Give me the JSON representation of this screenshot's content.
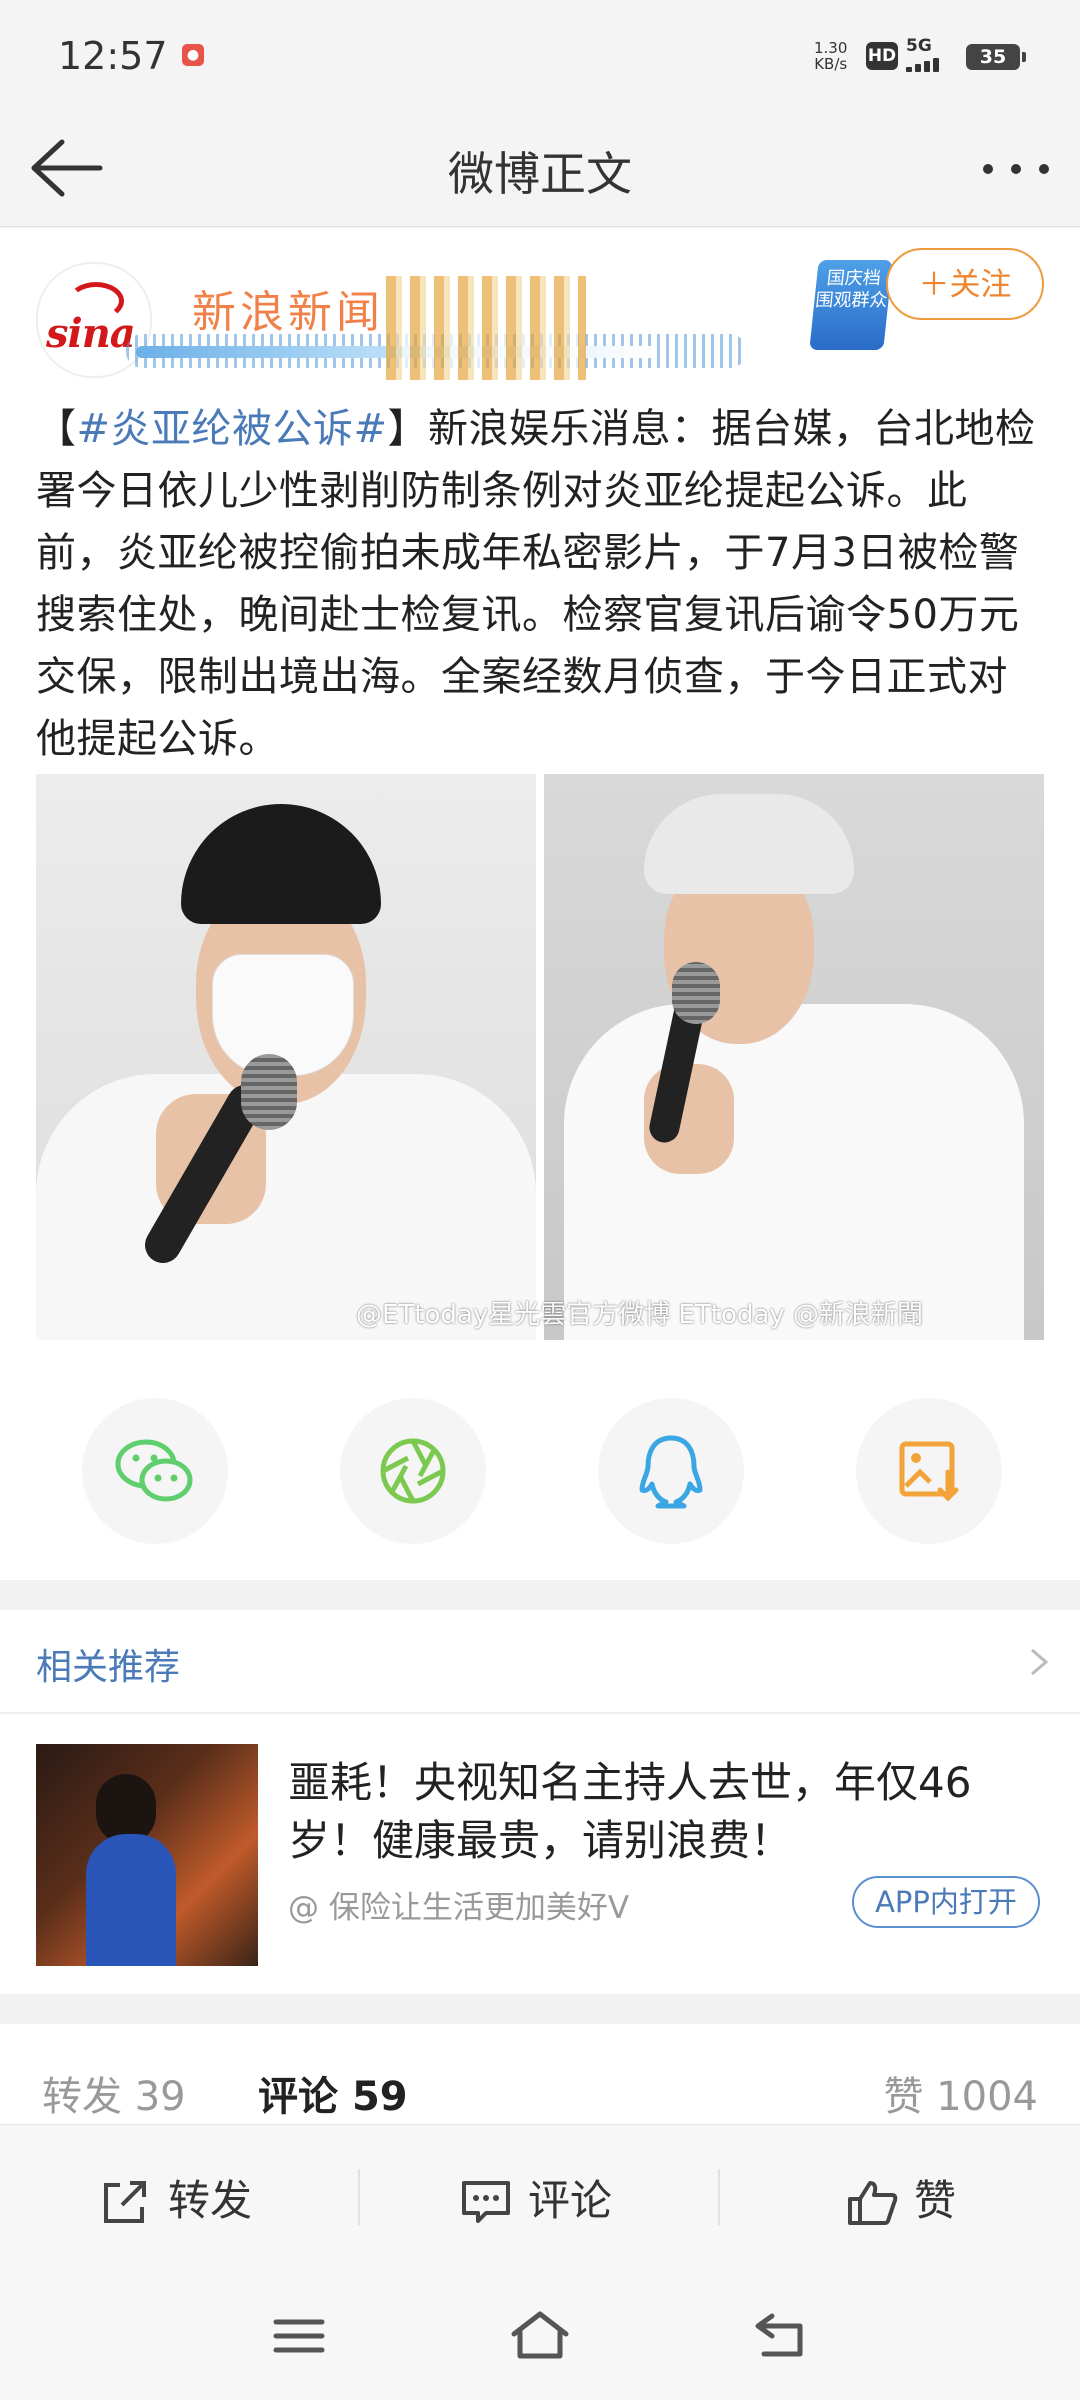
{
  "status_bar": {
    "time": "12:57",
    "net_speed_value": "1.30",
    "net_speed_unit": "KB/s",
    "hd": "HD",
    "signal": "5G",
    "battery": "35"
  },
  "nav": {
    "title": "微博正文",
    "back_icon": "arrow-left-icon",
    "more_icon": "more-dots-icon"
  },
  "post": {
    "banner_text": "新浪新闻",
    "promo_text_line1": "国庆档",
    "promo_text_line2": "围观群众",
    "follow_label": "＋关注",
    "hashtag": "#炎亚纶被公诉#",
    "bracket_open": "【",
    "bracket_close": "】",
    "body": "新浪娱乐消息：据台媒，台北地检署今日依儿少性剥削防制条例对炎亚纶提起公诉。此前，炎亚纶被控偷拍未成年私密影片，于7月3日被检警搜索住处，晚间赴士检复讯。检察官复讯后谕令50万元交保，限制出境出海。全案经数月侦查，于今日正式对他提起公诉。",
    "image_watermark": "@ETtoday星光雲官方微博 ETtoday @新浪新聞"
  },
  "share": [
    "wechat-icon",
    "moments-icon",
    "qq-icon",
    "save-image-icon"
  ],
  "related": {
    "header": "相关推荐",
    "title": "噩耗！央视知名主持人去世，年仅46岁！健康最贵，请别浪费！",
    "source": "@ 保险让生活更加美好V",
    "open_app": "APP内打开"
  },
  "stats": {
    "repost_label": "转发",
    "repost_count": "39",
    "comment_label": "评论",
    "comment_count": "59",
    "like_label": "赞",
    "like_count": "1004"
  },
  "actions": {
    "repost": "转发",
    "comment": "评论",
    "like": "赞"
  },
  "colors": {
    "link_blue": "#4b7ab8",
    "follow_orange": "#f0852f",
    "wechat_green": "#5fcf6e",
    "qq_blue": "#3aa7e4",
    "save_orange": "#f2a43a"
  }
}
